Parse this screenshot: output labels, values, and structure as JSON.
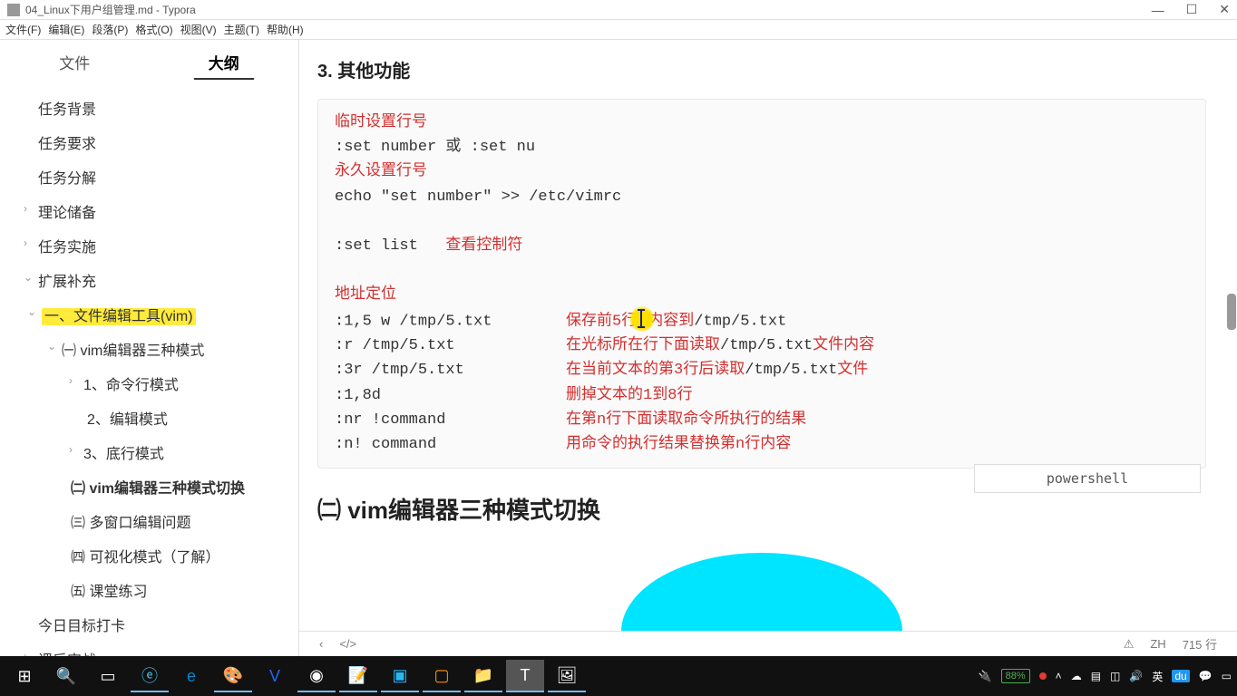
{
  "titlebar": {
    "title": "04_Linux下用户组管理.md - Typora"
  },
  "menubar": {
    "file": "文件(F)",
    "edit": "编辑(E)",
    "paragraph": "段落(P)",
    "format": "格式(O)",
    "view": "视图(V)",
    "theme": "主题(T)",
    "help": "帮助(H)"
  },
  "sidebar": {
    "tab_file": "文件",
    "tab_outline": "大纲",
    "items": {
      "task_bg": "任务背景",
      "task_req": "任务要求",
      "task_dec": "任务分解",
      "theory": "理论储备",
      "practice": "任务实施",
      "extend": "扩展补充",
      "sec1": "一、文件编辑工具(vim)",
      "sec1_1": "㈠ vim编辑器三种模式",
      "mode1": "1、命令行模式",
      "mode2": "2、编辑模式",
      "mode3": "3、底行模式",
      "sec1_2": "㈡ vim编辑器三种模式切换",
      "sec1_3": "㈢ 多窗口编辑问题",
      "sec1_4": "㈣ 可视化模式（了解）",
      "sec1_5": "㈤ 课堂练习",
      "today": "今日目标打卡",
      "after": "课后实战"
    }
  },
  "content": {
    "h3": "3. 其他功能",
    "h2": "㈡ vim编辑器三种模式切换",
    "code": {
      "l1": "临时设置行号",
      "l2": ":set number 或 :set nu",
      "l3": "永久设置行号",
      "l4": "echo \"set number\" >> /etc/vimrc",
      "l5": ":set list   ",
      "l5r": "查看控制符",
      "l6": "地址定位",
      "l7a": ":1,5 w /tmp/5.txt        ",
      "l7b1": "保存前5行",
      "l7b2": "内容到",
      "l7c": "/tmp/5.txt",
      "l8a": ":r /tmp/5.txt            ",
      "l8b": "在光标所在行下面读取",
      "l8c": "/tmp/5.txt",
      "l8d": "文件内容",
      "l9a": ":3r /tmp/5.txt           ",
      "l9b": "在当前文本的第3行后读取",
      "l9c": "/tmp/5.txt",
      "l9d": "文件",
      "l10a": ":1,8d                    ",
      "l10b": "删掉文本的1到8行",
      "l11a": ":nr !command             ",
      "l11b": "在第n行下面读取命令所执行的结果",
      "l12a": ":n! command              ",
      "l12b": "用命令的执行结果替换第n行内容"
    },
    "codelang": "powershell"
  },
  "footer": {
    "back": "‹",
    "code": "</>",
    "warn": "⚠",
    "lang": "ZH",
    "lines": "715 行"
  },
  "taskbar": {
    "battery": "88%"
  }
}
